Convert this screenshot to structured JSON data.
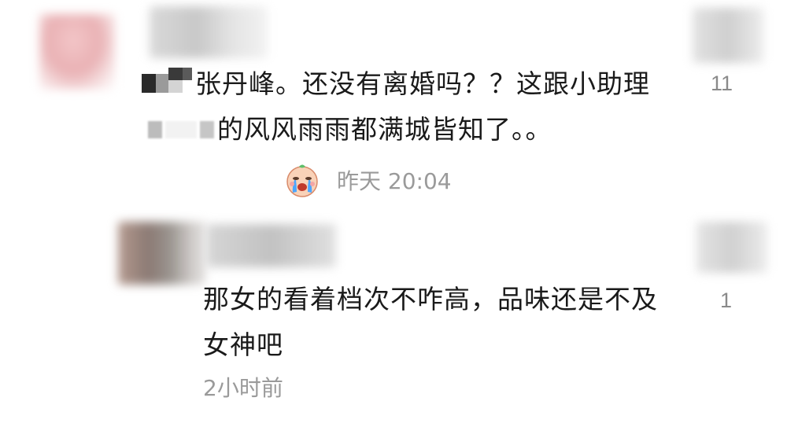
{
  "comments": [
    {
      "text": "张丹峰。还没有离婚吗？？这跟小助理",
      "text_after": "的风风雨雨都满城皆知了。。",
      "emoji": "crying-emoji",
      "time": "昨天 20:04",
      "likes": "11"
    },
    {
      "text": "那女的看着档次不咋高，品味还是不及女神吧",
      "time": "2小时前",
      "likes": "1"
    }
  ],
  "colors": {
    "text": "#1a1a1a",
    "meta": "#9a9a9a",
    "background": "#ffffff"
  }
}
